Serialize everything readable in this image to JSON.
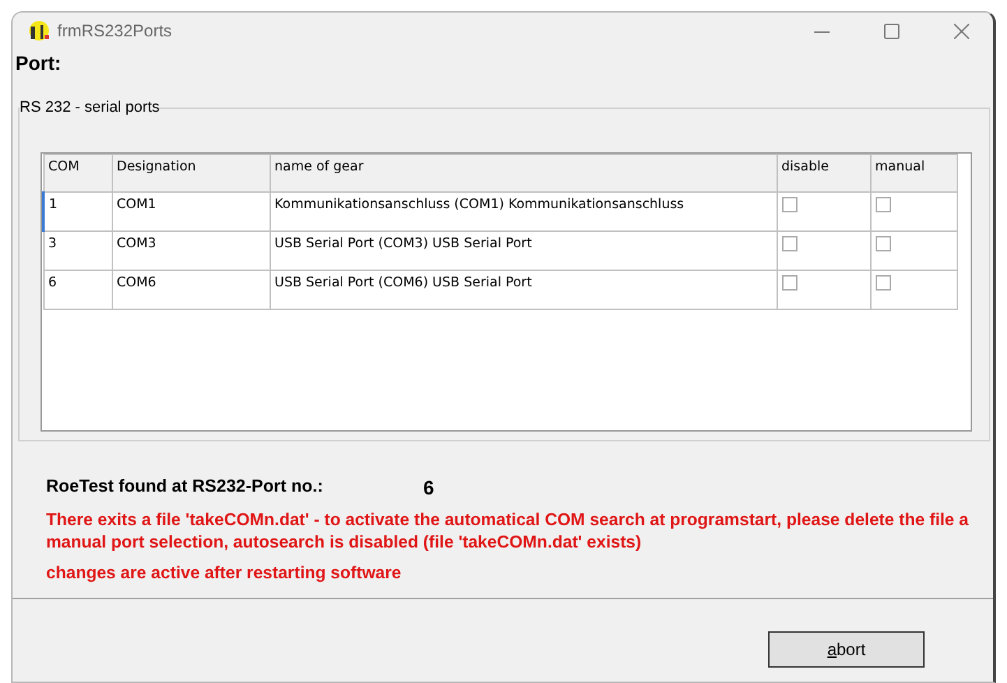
{
  "window": {
    "title": "frmRS232Ports"
  },
  "heading": "Port:",
  "group": {
    "title": "RS 232 - serial ports"
  },
  "table": {
    "columns": [
      "COM",
      "Designation",
      "name of gear",
      "disable",
      "manual"
    ],
    "rows": [
      {
        "com": "1",
        "designation": "COM1",
        "name": "Kommunikationsanschluss (COM1) Kommunikationsanschluss",
        "disable": false,
        "manual": false
      },
      {
        "com": "3",
        "designation": "COM3",
        "name": "USB Serial Port (COM3) USB Serial Port",
        "disable": false,
        "manual": false
      },
      {
        "com": "6",
        "designation": "COM6",
        "name": "USB Serial Port (COM6) USB Serial Port",
        "disable": false,
        "manual": false
      }
    ]
  },
  "found": {
    "label": "RoeTest found at RS232-Port no.:",
    "value": "6"
  },
  "messages": [
    "There exits a file 'takeCOMn.dat' - to activate the automatical COM search at programstart, please delete the file a",
    "manual port selection, autosearch is disabled (file 'takeCOMn.dat' exists)",
    "changes are active after restarting software"
  ],
  "buttons": [
    "abort"
  ]
}
